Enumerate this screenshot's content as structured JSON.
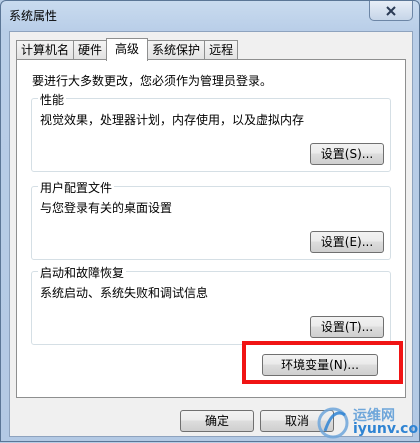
{
  "window": {
    "title": "系统属性"
  },
  "tabs": [
    {
      "label": "计算机名"
    },
    {
      "label": "硬件"
    },
    {
      "label": "高级"
    },
    {
      "label": "系统保护"
    },
    {
      "label": "远程"
    }
  ],
  "active_tab": "高级",
  "admin_note": "要进行大多数更改，您必须作为管理员登录。",
  "groups": {
    "performance": {
      "title": "性能",
      "description": "视觉效果，处理器计划，内存使用，以及虚拟内存",
      "button": "设置(S)..."
    },
    "user_profiles": {
      "title": "用户配置文件",
      "description": "与您登录有关的桌面设置",
      "button": "设置(E)..."
    },
    "startup_recovery": {
      "title": "启动和故障恢复",
      "description": "系统启动、系统失败和调试信息",
      "button": "设置(T)..."
    }
  },
  "env_button": "环境变量(N)...",
  "footer": {
    "ok": "确定",
    "cancel": "取消"
  },
  "watermark": {
    "line1": "运维网",
    "line2": "iyunv.com"
  },
  "colors": {
    "highlight": "#f01414",
    "watermark": "#2f84d3"
  }
}
